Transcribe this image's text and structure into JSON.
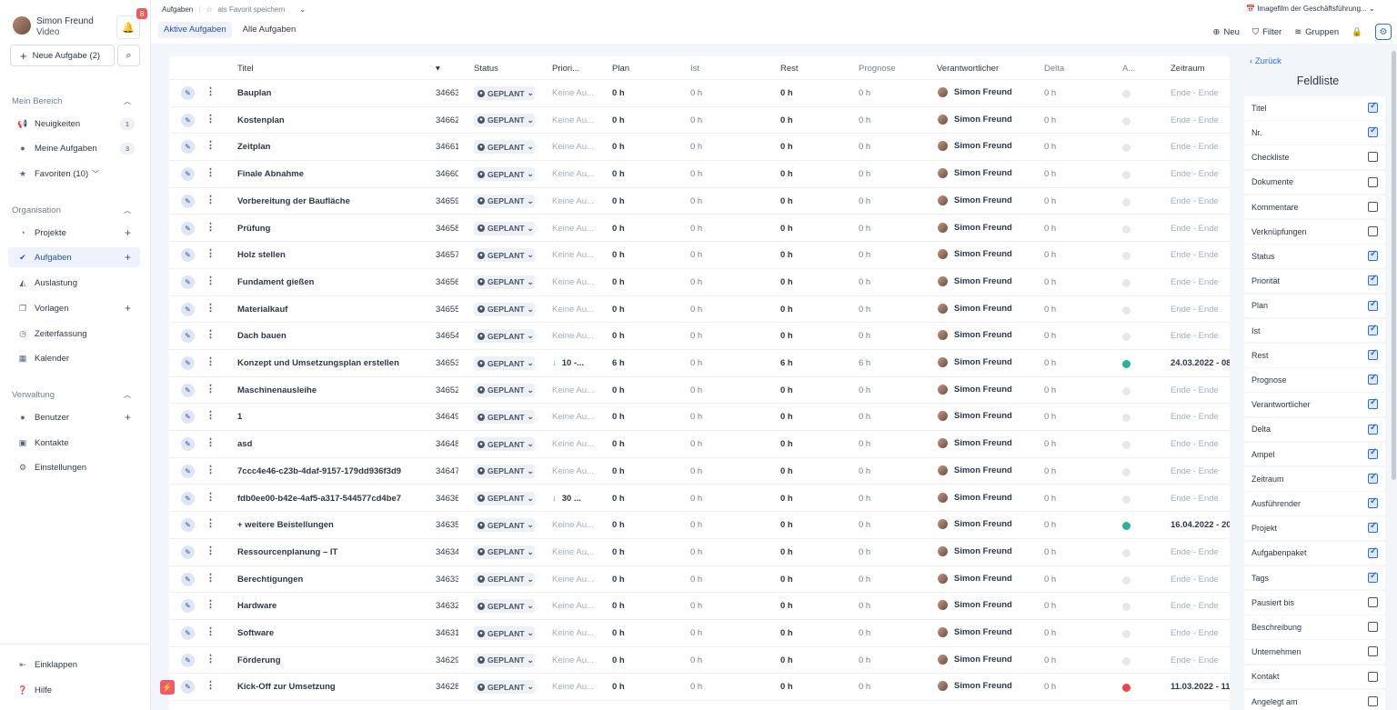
{
  "user": {
    "name": "Simon Freund",
    "role": "Video",
    "notifications": "8"
  },
  "sidebar": {
    "new_task": "Neue Aufgabe (2)",
    "sections": [
      {
        "title": "Mein Bereich",
        "items": [
          {
            "label": "Neuigkeiten",
            "icon": "megaphone-icon",
            "count": "1"
          },
          {
            "label": "Meine Aufgaben",
            "icon": "user-icon",
            "count": "3"
          },
          {
            "label": "Favoriten (10)",
            "icon": "star-icon"
          }
        ]
      },
      {
        "title": "Organisation",
        "items": [
          {
            "label": "Projekte",
            "icon": "pie-icon"
          },
          {
            "label": "Aufgaben",
            "icon": "check-circle-icon"
          },
          {
            "label": "Auslastung",
            "icon": "area-chart-icon"
          },
          {
            "label": "Vorlagen",
            "icon": "copy-icon"
          },
          {
            "label": "Zeiterfassung",
            "icon": "clock-icon"
          },
          {
            "label": "Kalender",
            "icon": "calendar-icon"
          }
        ]
      },
      {
        "title": "Verwaltung",
        "items": [
          {
            "label": "Benutzer",
            "icon": "user-icon"
          },
          {
            "label": "Kontakte",
            "icon": "contact-icon"
          },
          {
            "label": "Einstellungen",
            "icon": "gear-icon"
          }
        ]
      }
    ],
    "collapse": "Einklappen",
    "help": "Hilfe"
  },
  "header": {
    "crumb": "Aufgaben",
    "favorite": "als Favorit speichern",
    "tabs": [
      "Aktive Aufgaben",
      "Alle Aufgaben"
    ],
    "project": "Imagefilm der Geschäftsführung...",
    "new": "Neu",
    "filter": "Filter",
    "groups": "Gruppen"
  },
  "table": {
    "columns": {
      "title": "Titel",
      "status": "Status",
      "prio": "Priori...",
      "plan": "Plan",
      "ist": "Ist",
      "rest": "Rest",
      "prognose": "Prognose",
      "resp": "Verantwortlicher",
      "delta": "Delta",
      "ampel": "A...",
      "zeitraum": "Zeitraum"
    },
    "status_label": "GEPLANT",
    "rows": [
      {
        "title": "Bauplan",
        "nr": "34663",
        "prio": "Keine Au...",
        "plan": "0 h",
        "ist": "0 h",
        "rest": "0 h",
        "prog": "0 h",
        "resp": "Simon Freund",
        "delta": "0 h",
        "ampel": "gray",
        "zeit": "Ende - Ende"
      },
      {
        "title": "Kostenplan",
        "nr": "34662",
        "prio": "Keine Au...",
        "plan": "0 h",
        "ist": "0 h",
        "rest": "0 h",
        "prog": "0 h",
        "resp": "Simon Freund",
        "delta": "0 h",
        "ampel": "gray",
        "zeit": "Ende - Ende"
      },
      {
        "title": "Zeitplan",
        "nr": "34661",
        "prio": "Keine Au...",
        "plan": "0 h",
        "ist": "0 h",
        "rest": "0 h",
        "prog": "0 h",
        "resp": "Simon Freund",
        "delta": "0 h",
        "ampel": "gray",
        "zeit": "Ende - Ende"
      },
      {
        "title": "Finale Abnahme",
        "nr": "34660",
        "prio": "Keine Au...",
        "plan": "0 h",
        "ist": "0 h",
        "rest": "0 h",
        "prog": "0 h",
        "resp": "Simon Freund",
        "delta": "0 h",
        "ampel": "gray",
        "zeit": "Ende - Ende"
      },
      {
        "title": "Vorbereitung der Baufläche",
        "nr": "34659",
        "prio": "Keine Au...",
        "plan": "0 h",
        "ist": "0 h",
        "rest": "0 h",
        "prog": "0 h",
        "resp": "Simon Freund",
        "delta": "0 h",
        "ampel": "gray",
        "zeit": "Ende - Ende"
      },
      {
        "title": "Prüfung",
        "nr": "34658",
        "prio": "Keine Au...",
        "plan": "0 h",
        "ist": "0 h",
        "rest": "0 h",
        "prog": "0 h",
        "resp": "Simon Freund",
        "delta": "0 h",
        "ampel": "gray",
        "zeit": "Ende - Ende"
      },
      {
        "title": "Holz stellen",
        "nr": "34657",
        "prio": "Keine Au...",
        "plan": "0 h",
        "ist": "0 h",
        "rest": "0 h",
        "prog": "0 h",
        "resp": "Simon Freund",
        "delta": "0 h",
        "ampel": "gray",
        "zeit": "Ende - Ende"
      },
      {
        "title": "Fundament gießen",
        "nr": "34656",
        "prio": "Keine Au...",
        "plan": "0 h",
        "ist": "0 h",
        "rest": "0 h",
        "prog": "0 h",
        "resp": "Simon Freund",
        "delta": "0 h",
        "ampel": "gray",
        "zeit": "Ende - Ende"
      },
      {
        "title": "Materialkauf",
        "nr": "34655",
        "prio": "Keine Au...",
        "plan": "0 h",
        "ist": "0 h",
        "rest": "0 h",
        "prog": "0 h",
        "resp": "Simon Freund",
        "delta": "0 h",
        "ampel": "gray",
        "zeit": "Ende - Ende"
      },
      {
        "title": "Dach bauen",
        "nr": "34654",
        "prio": "Keine Au...",
        "plan": "0 h",
        "ist": "0 h",
        "rest": "0 h",
        "prog": "0 h",
        "resp": "Simon Freund",
        "delta": "0 h",
        "ampel": "gray",
        "zeit": "Ende - Ende"
      },
      {
        "title": "Konzept und Umsetzungsplan erstellen",
        "nr": "34653",
        "prio": "10 -...",
        "prio_set": true,
        "plan": "6 h",
        "ist": "0 h",
        "rest": "6 h",
        "prog": "6 h",
        "resp": "Simon Freund",
        "delta": "0 h",
        "ampel": "green",
        "zeit": "24.03.2022 - 08",
        "zeit_set": true
      },
      {
        "title": "Maschinenausleihe",
        "nr": "34652",
        "prio": "Keine Au...",
        "plan": "0 h",
        "ist": "0 h",
        "rest": "0 h",
        "prog": "0 h",
        "resp": "Simon Freund",
        "delta": "0 h",
        "ampel": "gray",
        "zeit": "Ende - Ende"
      },
      {
        "title": "1",
        "nr": "34649",
        "prio": "Keine Au...",
        "plan": "0 h",
        "ist": "0 h",
        "rest": "0 h",
        "prog": "0 h",
        "resp": "Simon Freund",
        "delta": "0 h",
        "ampel": "gray",
        "zeit": "Ende - Ende"
      },
      {
        "title": "asd",
        "nr": "34648",
        "prio": "Keine Au...",
        "plan": "0 h",
        "ist": "0 h",
        "rest": "0 h",
        "prog": "0 h",
        "resp": "Simon Freund",
        "delta": "0 h",
        "ampel": "gray",
        "zeit": "Ende - Ende"
      },
      {
        "title": "7ccc4e46-c23b-4daf-9157-179dd936f3d9",
        "nr": "34647",
        "prio": "Keine Au...",
        "plan": "0 h",
        "ist": "0 h",
        "rest": "0 h",
        "prog": "0 h",
        "resp": "Simon Freund",
        "delta": "0 h",
        "ampel": "gray",
        "zeit": "Ende - Ende"
      },
      {
        "title": "fdb0ee00-b42e-4af5-a317-544577cd4be7",
        "nr": "34636",
        "prio": "30 ...",
        "prio_set": true,
        "plan": "0 h",
        "ist": "0 h",
        "rest": "0 h",
        "prog": "0 h",
        "resp": "Simon Freund",
        "delta": "0 h",
        "ampel": "gray",
        "zeit": "Ende - Ende"
      },
      {
        "title": "+ weitere Beistellungen",
        "nr": "34635",
        "prio": "Keine Au...",
        "plan": "0 h",
        "ist": "0 h",
        "rest": "0 h",
        "prog": "0 h",
        "resp": "Simon Freund",
        "delta": "0 h",
        "ampel": "green",
        "zeit": "16.04.2022 - 20",
        "zeit_set": true
      },
      {
        "title": "Ressourcenplanung – IT",
        "nr": "34634",
        "prio": "Keine Au...",
        "plan": "0 h",
        "ist": "0 h",
        "rest": "0 h",
        "prog": "0 h",
        "resp": "Simon Freund",
        "delta": "0 h",
        "ampel": "gray",
        "zeit": "Ende - Ende"
      },
      {
        "title": "Berechtigungen",
        "nr": "34633",
        "prio": "Keine Au...",
        "plan": "0 h",
        "ist": "0 h",
        "rest": "0 h",
        "prog": "0 h",
        "resp": "Simon Freund",
        "delta": "0 h",
        "ampel": "gray",
        "zeit": "Ende - Ende"
      },
      {
        "title": "Hardware",
        "nr": "34632",
        "prio": "Keine Au...",
        "plan": "0 h",
        "ist": "0 h",
        "rest": "0 h",
        "prog": "0 h",
        "resp": "Simon Freund",
        "delta": "0 h",
        "ampel": "gray",
        "zeit": "Ende - Ende"
      },
      {
        "title": "Software",
        "nr": "34631",
        "prio": "Keine Au...",
        "plan": "0 h",
        "ist": "0 h",
        "rest": "0 h",
        "prog": "0 h",
        "resp": "Simon Freund",
        "delta": "0 h",
        "ampel": "gray",
        "zeit": "Ende - Ende"
      },
      {
        "title": "Förderung",
        "nr": "34629",
        "prio": "Keine Au...",
        "plan": "0 h",
        "ist": "0 h",
        "rest": "0 h",
        "prog": "0 h",
        "resp": "Simon Freund",
        "delta": "0 h",
        "ampel": "gray",
        "zeit": "Ende - Ende"
      },
      {
        "title": "Kick-Off zur Umsetzung",
        "nr": "34628",
        "prio": "Keine Au...",
        "plan": "0 h",
        "ist": "0 h",
        "rest": "0 h",
        "prog": "0 h",
        "resp": "Simon Freund",
        "delta": "0 h",
        "ampel": "red",
        "zeit": "11.03.2022 - 11.",
        "zeit_set": true,
        "bolt": true
      }
    ]
  },
  "panel": {
    "back": "Zurück",
    "title": "Feldliste",
    "fields": [
      {
        "label": "Titel",
        "checked": true
      },
      {
        "label": "Nr.",
        "checked": true
      },
      {
        "label": "Checkliste",
        "checked": false
      },
      {
        "label": "Dokumente",
        "checked": false
      },
      {
        "label": "Kommentare",
        "checked": false
      },
      {
        "label": "Verknüpfungen",
        "checked": false
      },
      {
        "label": "Status",
        "checked": true
      },
      {
        "label": "Priorität",
        "checked": true
      },
      {
        "label": "Plan",
        "checked": true
      },
      {
        "label": "Ist",
        "checked": true
      },
      {
        "label": "Rest",
        "checked": true
      },
      {
        "label": "Prognose",
        "checked": true
      },
      {
        "label": "Verantwortlicher",
        "checked": true
      },
      {
        "label": "Delta",
        "checked": true
      },
      {
        "label": "Ampel",
        "checked": true
      },
      {
        "label": "Zeitraum",
        "checked": true
      },
      {
        "label": "Ausführender",
        "checked": true
      },
      {
        "label": "Projekt",
        "checked": true
      },
      {
        "label": "Aufgabenpaket",
        "checked": true
      },
      {
        "label": "Tags",
        "checked": true
      },
      {
        "label": "Pausiert bis",
        "checked": false
      },
      {
        "label": "Beschreibung",
        "checked": false
      },
      {
        "label": "Unternehmen",
        "checked": false
      },
      {
        "label": "Kontakt",
        "checked": false
      },
      {
        "label": "Angelegt am",
        "checked": false
      }
    ]
  }
}
